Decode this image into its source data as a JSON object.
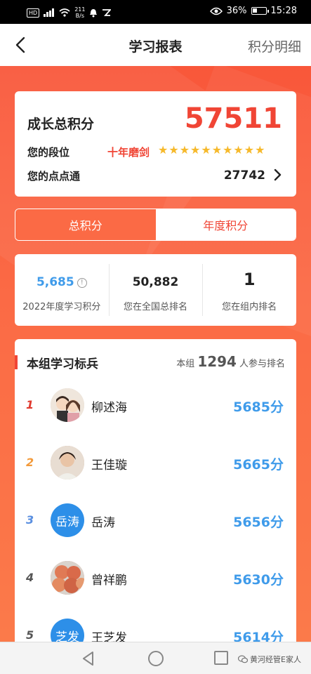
{
  "statusbar": {
    "badge": "HD",
    "net_top": "211",
    "net_bottom": "B/s",
    "battery_pct": "36%",
    "battery_fraction": 0.36,
    "time": "15:28"
  },
  "nav": {
    "title": "学习报表",
    "right_link": "积分明细"
  },
  "score": {
    "label": "成长总积分",
    "value": "57511",
    "rank_label": "您的段位",
    "rank_name": "十年磨剑",
    "stars": [
      "★",
      "★",
      "★",
      "★",
      "★",
      "★",
      "★",
      "★",
      "★",
      "★"
    ],
    "points_label": "您的点点通",
    "points_value": "27742"
  },
  "tabs": [
    {
      "label": "总积分",
      "active": true
    },
    {
      "label": "年度积分",
      "active": false
    }
  ],
  "stats": [
    {
      "value": "5,685",
      "label": "2022年度学习积分",
      "info": "!"
    },
    {
      "value": "50,882",
      "label": "您在全国总排名"
    },
    {
      "value": "1",
      "label": "您在组内排名"
    }
  ],
  "group": {
    "title": "本组学习标兵",
    "prefix": "本组",
    "count": "1294",
    "suffix": "人参与排名",
    "rows": [
      {
        "rank": "1",
        "name": "柳述海",
        "score": "5685分",
        "rank_color": "#e03a2f",
        "avatar_text": "",
        "avatar_bg": "#d9cfc4"
      },
      {
        "rank": "2",
        "name": "王佳璇",
        "score": "5665分",
        "rank_color": "#f39a3a",
        "avatar_text": "",
        "avatar_bg": "#c9a48a"
      },
      {
        "rank": "3",
        "name": "岳涛",
        "score": "5656分",
        "rank_color": "#5a8fe0",
        "avatar_text": "岳涛",
        "avatar_bg": "#2d8fe8"
      },
      {
        "rank": "4",
        "name": "曾祥鹏",
        "score": "5630分",
        "rank_color": "#555555",
        "avatar_text": "",
        "avatar_bg": "#d37a5b"
      },
      {
        "rank": "5",
        "name": "王芝发",
        "score": "5614分",
        "rank_color": "#555555",
        "avatar_text": "芝发",
        "avatar_bg": "#2d8fe8"
      }
    ]
  },
  "watermark": "黄河经管E家人"
}
